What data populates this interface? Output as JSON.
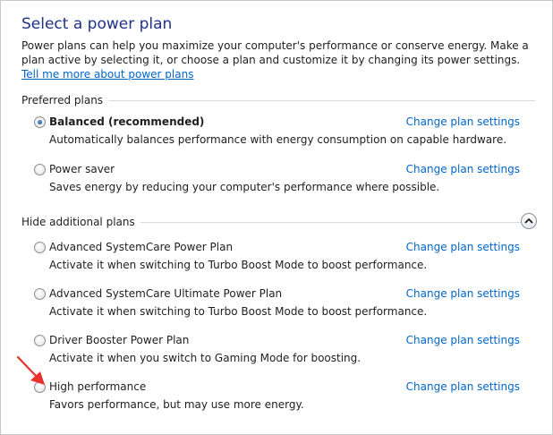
{
  "page": {
    "title": "Select a power plan",
    "intro_text": "Power plans can help you maximize your computer's performance or conserve energy. Make a plan active by selecting it, or choose a plan and customize it by changing its power settings. ",
    "intro_link": "Tell me more about power plans"
  },
  "preferred": {
    "header": "Preferred plans",
    "plans": [
      {
        "name": "Balanced (recommended)",
        "description": "Automatically balances performance with energy consumption on capable hardware.",
        "selected": true,
        "link": "Change plan settings"
      },
      {
        "name": "Power saver",
        "description": "Saves energy by reducing your computer's performance where possible.",
        "selected": false,
        "link": "Change plan settings"
      }
    ]
  },
  "additional": {
    "header": "Hide additional plans",
    "collapse_icon": "chevron-up-icon",
    "plans": [
      {
        "name": "Advanced SystemCare Power Plan",
        "description": "Activate it when switching to Turbo Boost Mode to boost performance.",
        "selected": false,
        "link": "Change plan settings"
      },
      {
        "name": "Advanced SystemCare Ultimate Power Plan",
        "description": "Activate it when switching to Turbo Boost Mode to boost performance.",
        "selected": false,
        "link": "Change plan settings"
      },
      {
        "name": "Driver Booster Power Plan",
        "description": "Activate it when you switch to Gaming Mode for boosting.",
        "selected": false,
        "link": "Change plan settings"
      },
      {
        "name": "High performance",
        "description": "Favors performance, but may use more energy.",
        "selected": false,
        "link": "Change plan settings"
      }
    ]
  },
  "annotation": {
    "icon": "red-arrow-icon",
    "color": "#e8312f"
  },
  "colors": {
    "title": "#1e3287",
    "link": "#0066cc",
    "radio_selected": "#1b4f9c"
  }
}
